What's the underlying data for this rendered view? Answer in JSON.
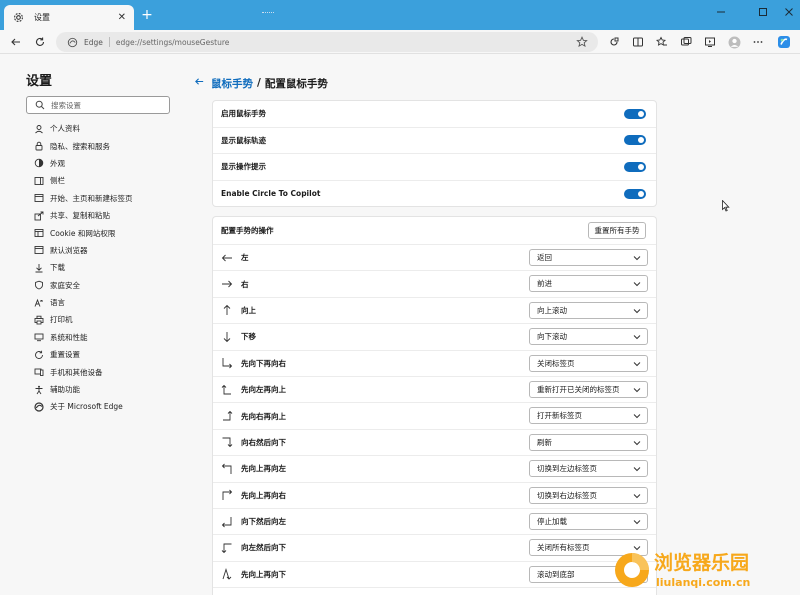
{
  "window": {
    "tab_title": "设置",
    "icons": {
      "tab": "gear-icon",
      "close": "close-icon",
      "new_tab": "plus-icon"
    }
  },
  "toolbar": {
    "brand": "Edge",
    "url": "edge://settings/mouseGesture"
  },
  "sidebar": {
    "title": "设置",
    "search_placeholder": "搜索设置",
    "items": [
      {
        "label": "个人资料",
        "icon": "profile-icon"
      },
      {
        "label": "隐私、搜索和服务",
        "icon": "lock-icon"
      },
      {
        "label": "外观",
        "icon": "appearance-icon"
      },
      {
        "label": "侧栏",
        "icon": "sidebar-icon"
      },
      {
        "label": "开始、主页和新建标签页",
        "icon": "home-icon"
      },
      {
        "label": "共享、复制和粘贴",
        "icon": "share-icon"
      },
      {
        "label": "Cookie 和网站权限",
        "icon": "cookie-icon"
      },
      {
        "label": "默认浏览器",
        "icon": "browser-icon"
      },
      {
        "label": "下载",
        "icon": "download-icon"
      },
      {
        "label": "家庭安全",
        "icon": "family-icon"
      },
      {
        "label": "语言",
        "icon": "language-icon"
      },
      {
        "label": "打印机",
        "icon": "printer-icon"
      },
      {
        "label": "系统和性能",
        "icon": "system-icon"
      },
      {
        "label": "重置设置",
        "icon": "reset-icon"
      },
      {
        "label": "手机和其他设备",
        "icon": "phone-icon"
      },
      {
        "label": "辅助功能",
        "icon": "accessibility-icon"
      },
      {
        "label": "关于 Microsoft Edge",
        "icon": "edge-logo-icon"
      }
    ]
  },
  "breadcrumb": {
    "parent": "鼠标手势",
    "separator": "/",
    "current": "配置鼠标手势"
  },
  "toggles": [
    {
      "label": "启用鼠标手势",
      "on": true
    },
    {
      "label": "显示鼠标轨迹",
      "on": true
    },
    {
      "label": "显示操作提示",
      "on": true
    },
    {
      "label": "Enable Circle To Copilot",
      "on": true
    }
  ],
  "gestures": {
    "header": "配置手势的操作",
    "reset_label": "重置所有手势",
    "rows": [
      {
        "name": "左",
        "icon": "arrow-left-icon",
        "action": "返回"
      },
      {
        "name": "右",
        "icon": "arrow-right-icon",
        "action": "前进"
      },
      {
        "name": "向上",
        "icon": "arrow-up-icon",
        "action": "向上滚动"
      },
      {
        "name": "下移",
        "icon": "arrow-down-icon",
        "action": "向下滚动"
      },
      {
        "name": "先向下再向右",
        "icon": "down-right-icon",
        "action": "关闭标签页"
      },
      {
        "name": "先向左再向上",
        "icon": "left-up-icon",
        "action": "重新打开已关闭的标签页"
      },
      {
        "name": "先向右再向上",
        "icon": "right-up-icon",
        "action": "打开新标签页"
      },
      {
        "name": "向右然后向下",
        "icon": "right-down-icon",
        "action": "刷新"
      },
      {
        "name": "先向上再向左",
        "icon": "up-left-icon",
        "action": "切换到左边标签页"
      },
      {
        "name": "先向上再向右",
        "icon": "up-right-icon",
        "action": "切换到右边标签页"
      },
      {
        "name": "向下然后向左",
        "icon": "down-left-icon",
        "action": "停止加载"
      },
      {
        "name": "向左然后向下",
        "icon": "left-down-icon",
        "action": "关闭所有标签页"
      },
      {
        "name": "先向上再向下",
        "icon": "up-down-icon",
        "action": "滚动到底部"
      }
    ]
  },
  "watermark": {
    "cn": "浏览器乐园",
    "en": "liulanqi.com.cn"
  },
  "colors": {
    "titlebar": "#3ba0dc",
    "accent": "#0f6cbd",
    "watermark": "#f7a81b"
  }
}
